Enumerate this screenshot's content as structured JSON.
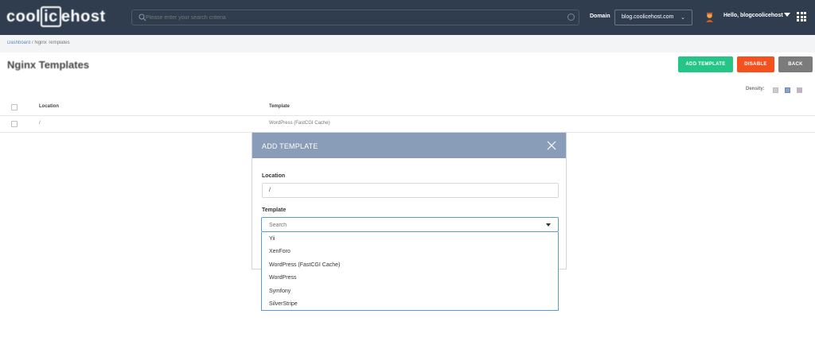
{
  "header": {
    "logo_text_a": "cool",
    "logo_text_b": "ic",
    "logo_text_c": "ehost",
    "search_placeholder": "Please enter your search criteria",
    "domain_label": "Domain",
    "domain_value": "blog.coolicehost.com",
    "greeting": "Hello, blogcoolicehost"
  },
  "breadcrumb": {
    "home": "Dashboard",
    "separator": " / ",
    "current": "Nginx Templates"
  },
  "page": {
    "title": "Nginx Templates",
    "buttons": {
      "add_template": "ADD TEMPLATE",
      "disable": "DISABLE",
      "back": "BACK"
    },
    "density_label": "Density:"
  },
  "table": {
    "columns": [
      "Location",
      "Template"
    ],
    "rows": [
      {
        "location": "/",
        "template": "WordPress (FastCGI Cache)"
      }
    ]
  },
  "modal": {
    "title": "ADD TEMPLATE",
    "location_label": "Location",
    "location_value": "/",
    "template_label": "Template",
    "template_placeholder": "Search",
    "options": [
      "Yii",
      "XenForo",
      "WordPress (FastCGI Cache)",
      "WordPress",
      "Symfony",
      "SilverStripe"
    ]
  },
  "colors": {
    "topbar": "#2f3d4f",
    "modal_header": "#8a9db8",
    "add_button": "#25c588",
    "disable_button": "#f4511e",
    "back_button": "#7b7b7b",
    "focus_border": "#5b9bd5"
  }
}
